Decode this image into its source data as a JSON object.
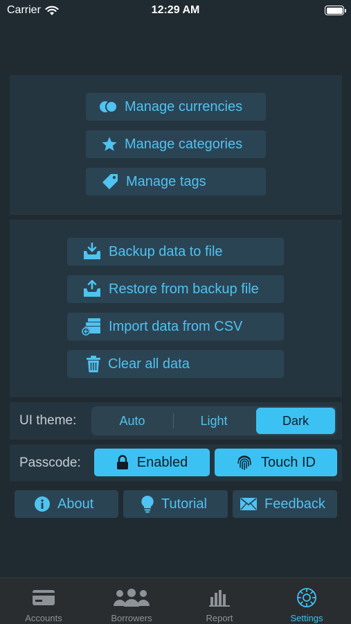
{
  "status_bar": {
    "carrier": "Carrier",
    "time": "12:29 AM"
  },
  "manage": {
    "currencies": {
      "label": "Manage currencies",
      "icon": "coins-icon"
    },
    "categories": {
      "label": "Manage categories",
      "icon": "star-icon"
    },
    "tags": {
      "label": "Manage tags",
      "icon": "tag-icon"
    }
  },
  "data": {
    "backup": {
      "label": "Backup data to file",
      "icon": "tray-download-icon"
    },
    "restore": {
      "label": "Restore from backup file",
      "icon": "tray-upload-icon"
    },
    "import_csv": {
      "label": "Import data from CSV",
      "icon": "stack-add-icon"
    },
    "clear": {
      "label": "Clear all data",
      "icon": "trash-icon"
    }
  },
  "theme": {
    "label": "UI theme:",
    "options": [
      "Auto",
      "Light",
      "Dark"
    ],
    "selected": "Dark"
  },
  "passcode": {
    "label": "Passcode:",
    "enabled_label": "Enabled",
    "touch_id_label": "Touch ID"
  },
  "links": {
    "about": "About",
    "tutorial": "Tutorial",
    "feedback": "Feedback"
  },
  "tabbar": {
    "items": [
      {
        "label": "Accounts",
        "icon": "card-icon"
      },
      {
        "label": "Borrowers",
        "icon": "people-icon"
      },
      {
        "label": "Report",
        "icon": "bar-chart-icon"
      },
      {
        "label": "Settings",
        "icon": "gear-icon"
      }
    ],
    "active": "Settings"
  },
  "colors": {
    "accent": "#3cc2f2",
    "background": "#202a31",
    "panel": "#253540",
    "button": "#2b4454"
  }
}
